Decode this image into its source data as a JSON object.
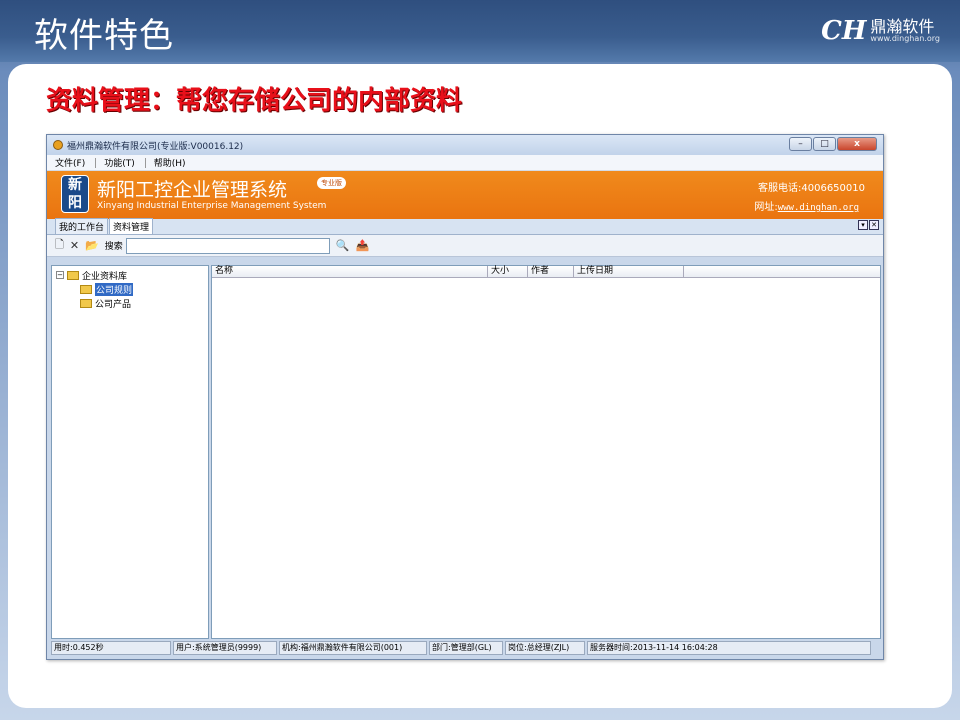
{
  "slide": {
    "title": "软件特色",
    "brand_logo": "CH",
    "brand_name": "鼎瀚软件",
    "brand_url": "www.dinghan.org",
    "headline": "资料管理：帮您存储公司的内部资料"
  },
  "window": {
    "title": "福州鼎瀚软件有限公司(专业版:V00016.12)",
    "buttons": {
      "minimize": "–",
      "maximize": "□",
      "close": "x"
    }
  },
  "menu": [
    "文件(F)",
    "功能(T)",
    "帮助(H)"
  ],
  "banner": {
    "logo": "新阳",
    "title": "新阳工控企业管理系统",
    "edition": "专业版",
    "subtitle": "Xinyang Industrial Enterprise Management System",
    "phone": "客服电话:4006650010",
    "site_label": "网址:",
    "site_url": "www.dinghan.org"
  },
  "tabs": [
    "我的工作台",
    "资料管理"
  ],
  "tab_controls": [
    "▾",
    "✕"
  ],
  "toolbar": {
    "new_icon": "🗋",
    "delete_icon": "✕",
    "open_icon": "📂",
    "search_label": "搜索",
    "search_value": "",
    "find_icon": "🔍",
    "export_icon": "📤"
  },
  "tree": {
    "root": "企业资料库",
    "children": [
      "公司规则",
      "公司产品"
    ],
    "selected": "公司规则"
  },
  "list_columns": [
    "名称",
    "大小",
    "作者",
    "上传日期"
  ],
  "statusbar": [
    "用时:0.452秒",
    "用户:系统管理员(9999)",
    "机构:福州鼎瀚软件有限公司(001)",
    "部门:管理部(GL)",
    "岗位:总经理(ZJL)",
    "服务器时间:2013-11-14 16:04:28"
  ]
}
